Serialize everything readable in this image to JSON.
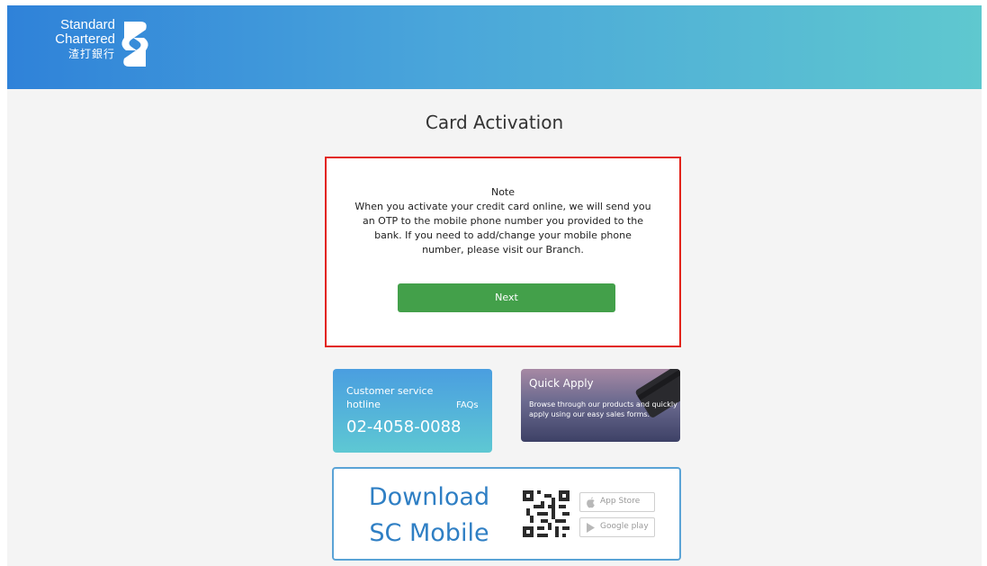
{
  "brand": {
    "line1": "Standard",
    "line2": "Chartered",
    "line3": "渣打銀行"
  },
  "page": {
    "title": "Card Activation"
  },
  "note": {
    "heading": "Note",
    "body": "When you activate your credit card online, we will send you an OTP to the mobile phone number you provided to the bank. If you need to add/change your mobile phone number, please visit our Branch.",
    "button_label": "Next"
  },
  "hotline": {
    "label_line1": "Customer service",
    "label_line2": "hotline",
    "faq_label": "FAQs",
    "number": "02-4058-0088"
  },
  "quick_apply": {
    "title": "Quick Apply",
    "description": "Browse through our products and quickly apply using our easy sales forms."
  },
  "download": {
    "line1": "Download",
    "line2": "SC Mobile",
    "app_store_label": "App Store",
    "google_play_label": "Google play"
  },
  "colors": {
    "header_start": "#2f82d9",
    "header_end": "#5fc8cf",
    "next_button": "#43a04a",
    "highlight_border": "#e2231a",
    "download_blue": "#2f7fc4"
  },
  "icons": [
    "sc-logo-icon",
    "apple-icon",
    "google-play-icon",
    "qr-code-icon",
    "credit-card-image"
  ]
}
